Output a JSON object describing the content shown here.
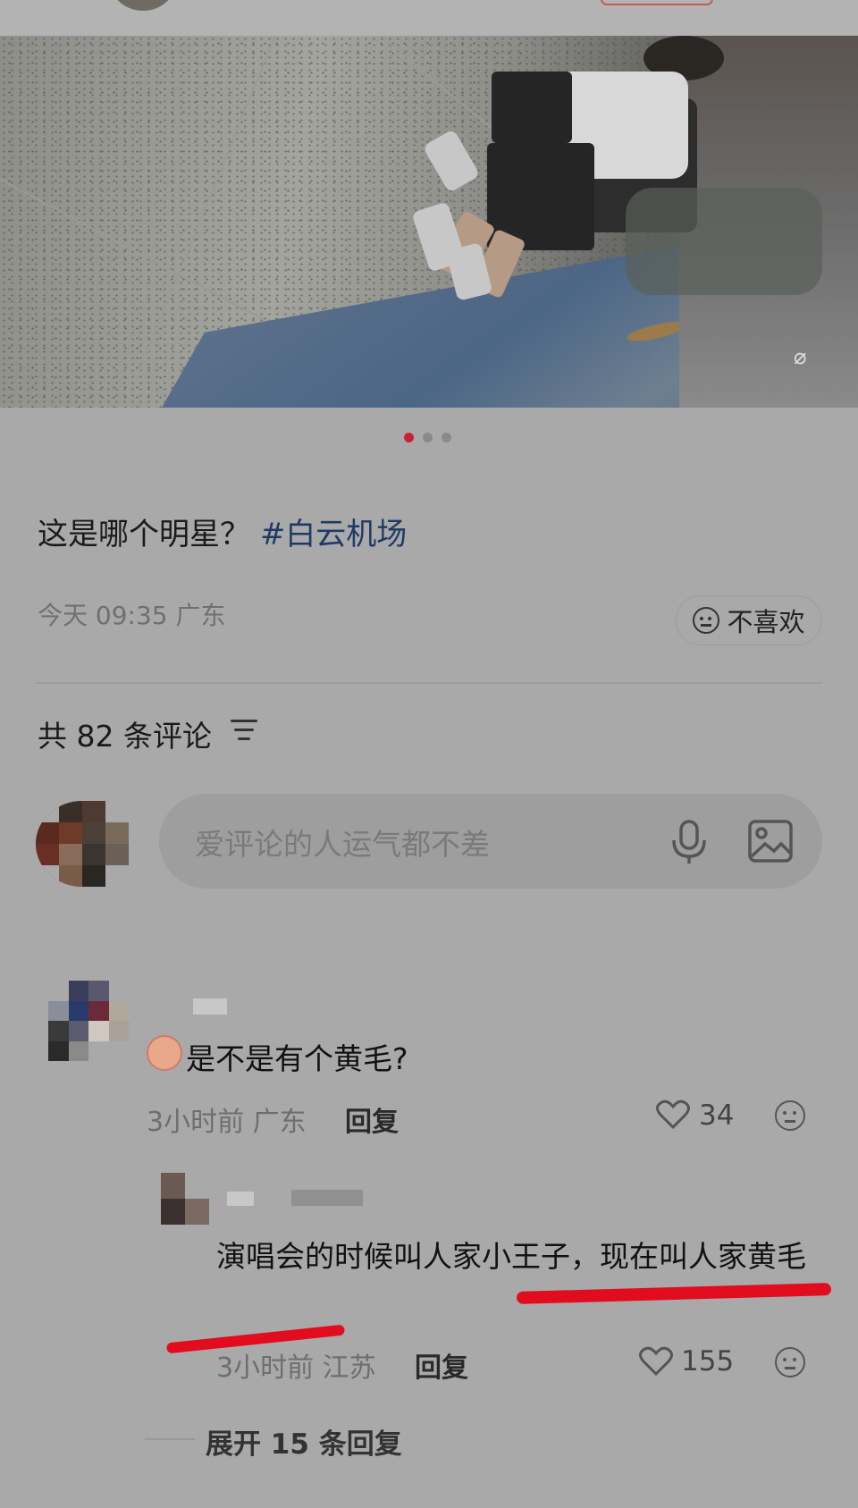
{
  "carousel": {
    "dot_count": 3,
    "active_index": 0
  },
  "post": {
    "caption": "这是哪个明星？",
    "hashtag": "#白云机场",
    "time": "今天 09:35",
    "location": "广东",
    "dislike_label": "不喜欢"
  },
  "comments_header": {
    "prefix": "共",
    "count": "82",
    "suffix": "条评论"
  },
  "comment_input": {
    "placeholder": "爱评论的人运气都不差"
  },
  "comments": [
    {
      "text": "是不是有个黄毛?",
      "time": "3小时前",
      "location": "广东",
      "reply_label": "回复",
      "likes": "34"
    }
  ],
  "replies": [
    {
      "text": "演唱会的时候叫人家小王子，现在叫人家黄毛",
      "time": "3小时前",
      "location": "江苏",
      "reply_label": "回复",
      "likes": "155"
    }
  ],
  "expand_replies": {
    "label": "展开 15 条回复"
  },
  "colors": {
    "active_dot": "#c8213a",
    "hashtag": "#203a66",
    "annotation_red": "#e10c1e"
  }
}
